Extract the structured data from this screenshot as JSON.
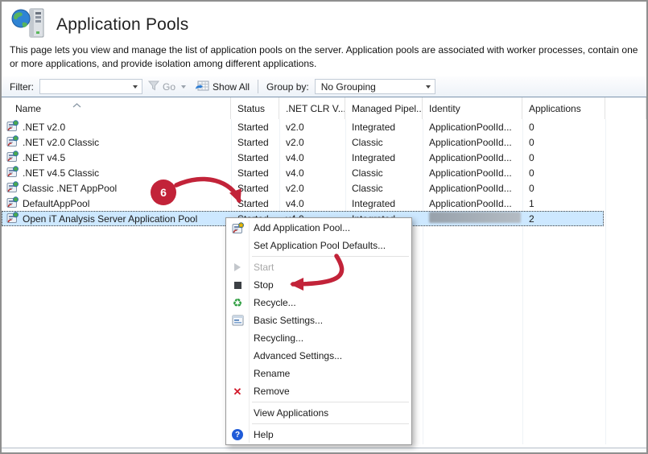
{
  "page": {
    "title": "Application Pools",
    "description": "This page lets you view and manage the list of application pools on the server. Application pools are associated with worker processes, contain one or more applications, and provide isolation among different applications.",
    "header_icon": "iis-server-globe-icon"
  },
  "toolbar": {
    "filter_label": "Filter:",
    "filter_value": "",
    "go_label": "Go",
    "go_icon": "filter-funnel-icon",
    "show_all_label": "Show All",
    "show_all_icon": "show-all-grid-icon",
    "group_by_label": "Group by:",
    "group_by_value": "No Grouping"
  },
  "table": {
    "columns": [
      "Name",
      "Status",
      ".NET CLR V...",
      "Managed Pipel...",
      "Identity",
      "Applications"
    ],
    "sort": {
      "column": "Name",
      "direction": "ascending"
    },
    "row_icon": "app-pool-icon",
    "rows": [
      {
        "name": ".NET v2.0",
        "status": "Started",
        "clr": "v2.0",
        "pipeline": "Integrated",
        "identity": "ApplicationPoolId...",
        "applications": "0",
        "selected": false,
        "identity_redacted": false
      },
      {
        "name": ".NET v2.0 Classic",
        "status": "Started",
        "clr": "v2.0",
        "pipeline": "Classic",
        "identity": "ApplicationPoolId...",
        "applications": "0",
        "selected": false,
        "identity_redacted": false
      },
      {
        "name": ".NET v4.5",
        "status": "Started",
        "clr": "v4.0",
        "pipeline": "Integrated",
        "identity": "ApplicationPoolId...",
        "applications": "0",
        "selected": false,
        "identity_redacted": false
      },
      {
        "name": ".NET v4.5 Classic",
        "status": "Started",
        "clr": "v4.0",
        "pipeline": "Classic",
        "identity": "ApplicationPoolId...",
        "applications": "0",
        "selected": false,
        "identity_redacted": false
      },
      {
        "name": "Classic .NET AppPool",
        "status": "Started",
        "clr": "v2.0",
        "pipeline": "Classic",
        "identity": "ApplicationPoolId...",
        "applications": "0",
        "selected": false,
        "identity_redacted": false
      },
      {
        "name": "DefaultAppPool",
        "status": "Started",
        "clr": "v4.0",
        "pipeline": "Integrated",
        "identity": "ApplicationPoolId...",
        "applications": "1",
        "selected": false,
        "identity_redacted": false
      },
      {
        "name": "Open iT Analysis Server Application Pool",
        "status": "Started",
        "clr": "v4.0",
        "pipeline": "Integrated",
        "identity": "",
        "applications": "2",
        "selected": true,
        "identity_redacted": true
      }
    ]
  },
  "context_menu": {
    "items": [
      {
        "label": "Add Application Pool...",
        "icon": "add-app-pool-icon",
        "disabled": false
      },
      {
        "label": "Set Application Pool Defaults...",
        "disabled": false
      },
      {
        "type": "separator"
      },
      {
        "label": "Start",
        "icon": "start-icon",
        "disabled": true
      },
      {
        "label": "Stop",
        "icon": "stop-icon",
        "disabled": false
      },
      {
        "label": "Recycle...",
        "icon": "recycle-icon",
        "disabled": false
      },
      {
        "label": "Basic Settings...",
        "icon": "basic-settings-icon",
        "disabled": false
      },
      {
        "label": "Recycling...",
        "disabled": false
      },
      {
        "label": "Advanced Settings...",
        "disabled": false
      },
      {
        "label": "Rename",
        "disabled": false
      },
      {
        "label": "Remove",
        "icon": "remove-icon",
        "disabled": false
      },
      {
        "type": "separator"
      },
      {
        "label": "View Applications",
        "disabled": false
      },
      {
        "type": "separator"
      },
      {
        "label": "Help",
        "icon": "help-icon",
        "disabled": false
      }
    ]
  },
  "annotations": {
    "step_number": "6",
    "accent_color": "#c22339"
  },
  "colors": {
    "selection_blue": "#cde8ff",
    "annotation_red": "#c22339",
    "toolbar_border": "#7d95ae",
    "window_border": "#8f8f8f"
  }
}
